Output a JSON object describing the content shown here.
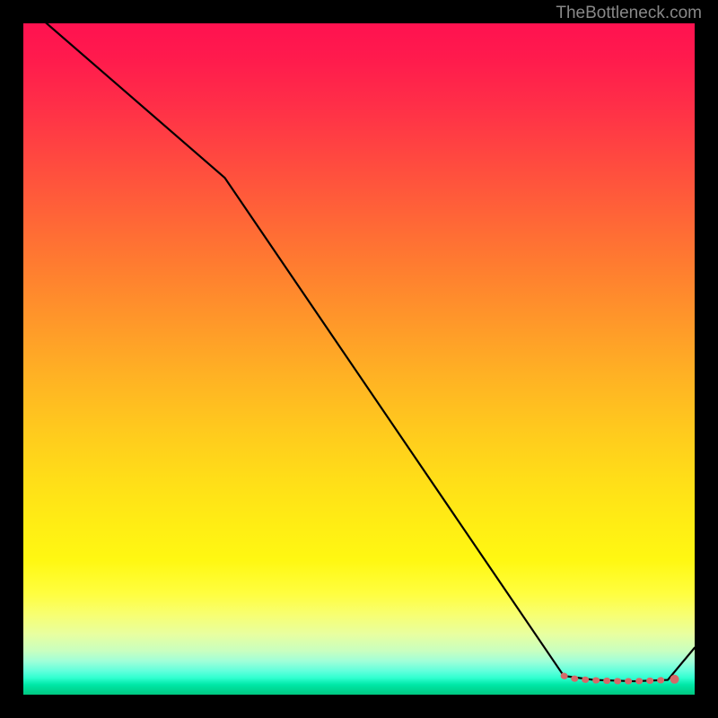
{
  "watermark": "TheBottleneck.com",
  "chart_data": {
    "type": "line",
    "title": "",
    "xlabel": "",
    "ylabel": "",
    "xlim": [
      0,
      100
    ],
    "ylim": [
      0,
      100
    ],
    "series": [
      {
        "name": "bottleneck-curve",
        "x": [
          0,
          30,
          80.5,
          85,
          91,
          96,
          100
        ],
        "values": [
          103,
          77,
          2.8,
          2.2,
          2.0,
          2.2,
          7
        ]
      }
    ],
    "markers": {
      "name": "highlight-segment",
      "color": "#d66868",
      "points": [
        {
          "x": 80.5,
          "y": 2.8
        },
        {
          "x": 82,
          "y": 2.4
        },
        {
          "x": 84,
          "y": 2.2
        },
        {
          "x": 86,
          "y": 2.1
        },
        {
          "x": 87.5,
          "y": 2.05
        },
        {
          "x": 89,
          "y": 2.0
        },
        {
          "x": 91,
          "y": 2.0
        },
        {
          "x": 92.5,
          "y": 2.05
        },
        {
          "x": 94,
          "y": 2.1
        },
        {
          "x": 96,
          "y": 2.2
        }
      ]
    },
    "gradient_stops": [
      {
        "pos": 0,
        "color": "#ff1250"
      },
      {
        "pos": 50,
        "color": "#ffb024"
      },
      {
        "pos": 75,
        "color": "#ffee14"
      },
      {
        "pos": 95,
        "color": "#a0ffd8"
      },
      {
        "pos": 100,
        "color": "#00c880"
      }
    ]
  }
}
